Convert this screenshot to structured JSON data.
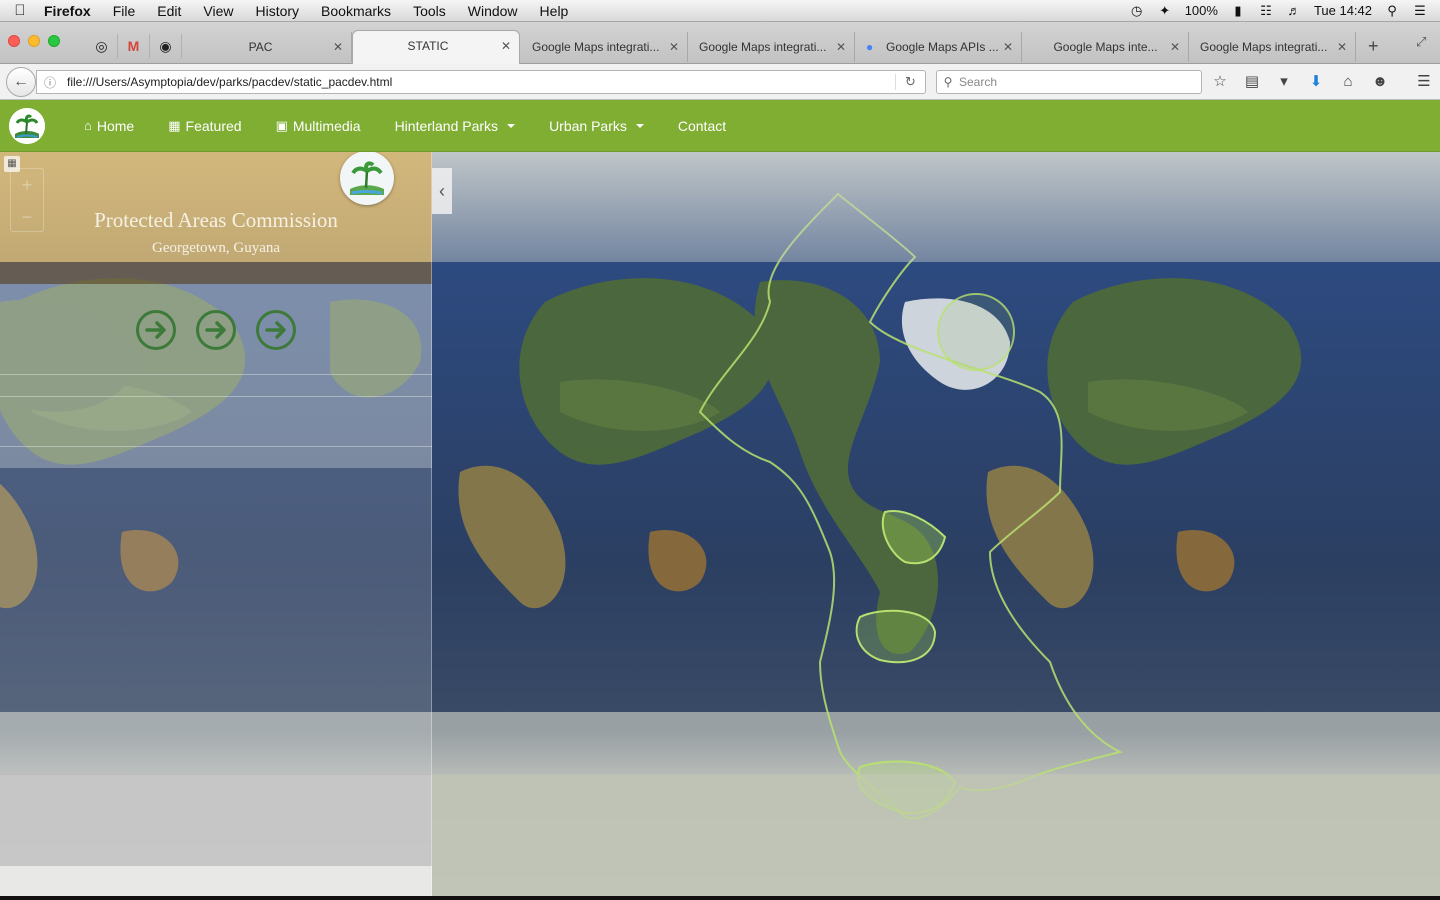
{
  "os_menubar": {
    "app_name": "Firefox",
    "menus": [
      "File",
      "Edit",
      "View",
      "History",
      "Bookmarks",
      "Tools",
      "Window",
      "Help"
    ],
    "battery": "100%",
    "clock": "Tue 14:42"
  },
  "browser": {
    "tabs": [
      {
        "label": "PAC",
        "active": false
      },
      {
        "label": "STATIC",
        "active": true
      },
      {
        "label": "Google Maps integrati...",
        "active": false
      },
      {
        "label": "Google Maps integrati...",
        "active": false
      },
      {
        "label": "Google Maps APIs ...",
        "active": false
      },
      {
        "label": "Google Maps inte...",
        "active": false
      },
      {
        "label": "Google Maps integrati...",
        "active": false
      }
    ],
    "url": "file:///Users/Asymptopia/dev/parks/pacdev/static_pacdev.html",
    "search_placeholder": "Search"
  },
  "site_nav": {
    "items": [
      {
        "label": "Home",
        "icon": "home-icon",
        "dropdown": false
      },
      {
        "label": "Featured",
        "icon": "film-icon",
        "dropdown": false
      },
      {
        "label": "Multimedia",
        "icon": "image-icon",
        "dropdown": false
      },
      {
        "label": "Hinterland Parks",
        "icon": "",
        "dropdown": true
      },
      {
        "label": "Urban Parks",
        "icon": "",
        "dropdown": true
      },
      {
        "label": "Contact",
        "icon": "",
        "dropdown": false
      }
    ]
  },
  "sidebar": {
    "title": "Protected Areas Commission",
    "subtitle": "Georgetown, Guyana",
    "arrow_buttons": [
      "arrow-right-icon",
      "arrow-right-icon",
      "arrow-right-icon"
    ]
  },
  "colors": {
    "nav_green": "#7fae33",
    "sidebar_header": "#d6b672",
    "arrow_green": "#3d7a3a",
    "overlay_outline": "#b8e070"
  }
}
